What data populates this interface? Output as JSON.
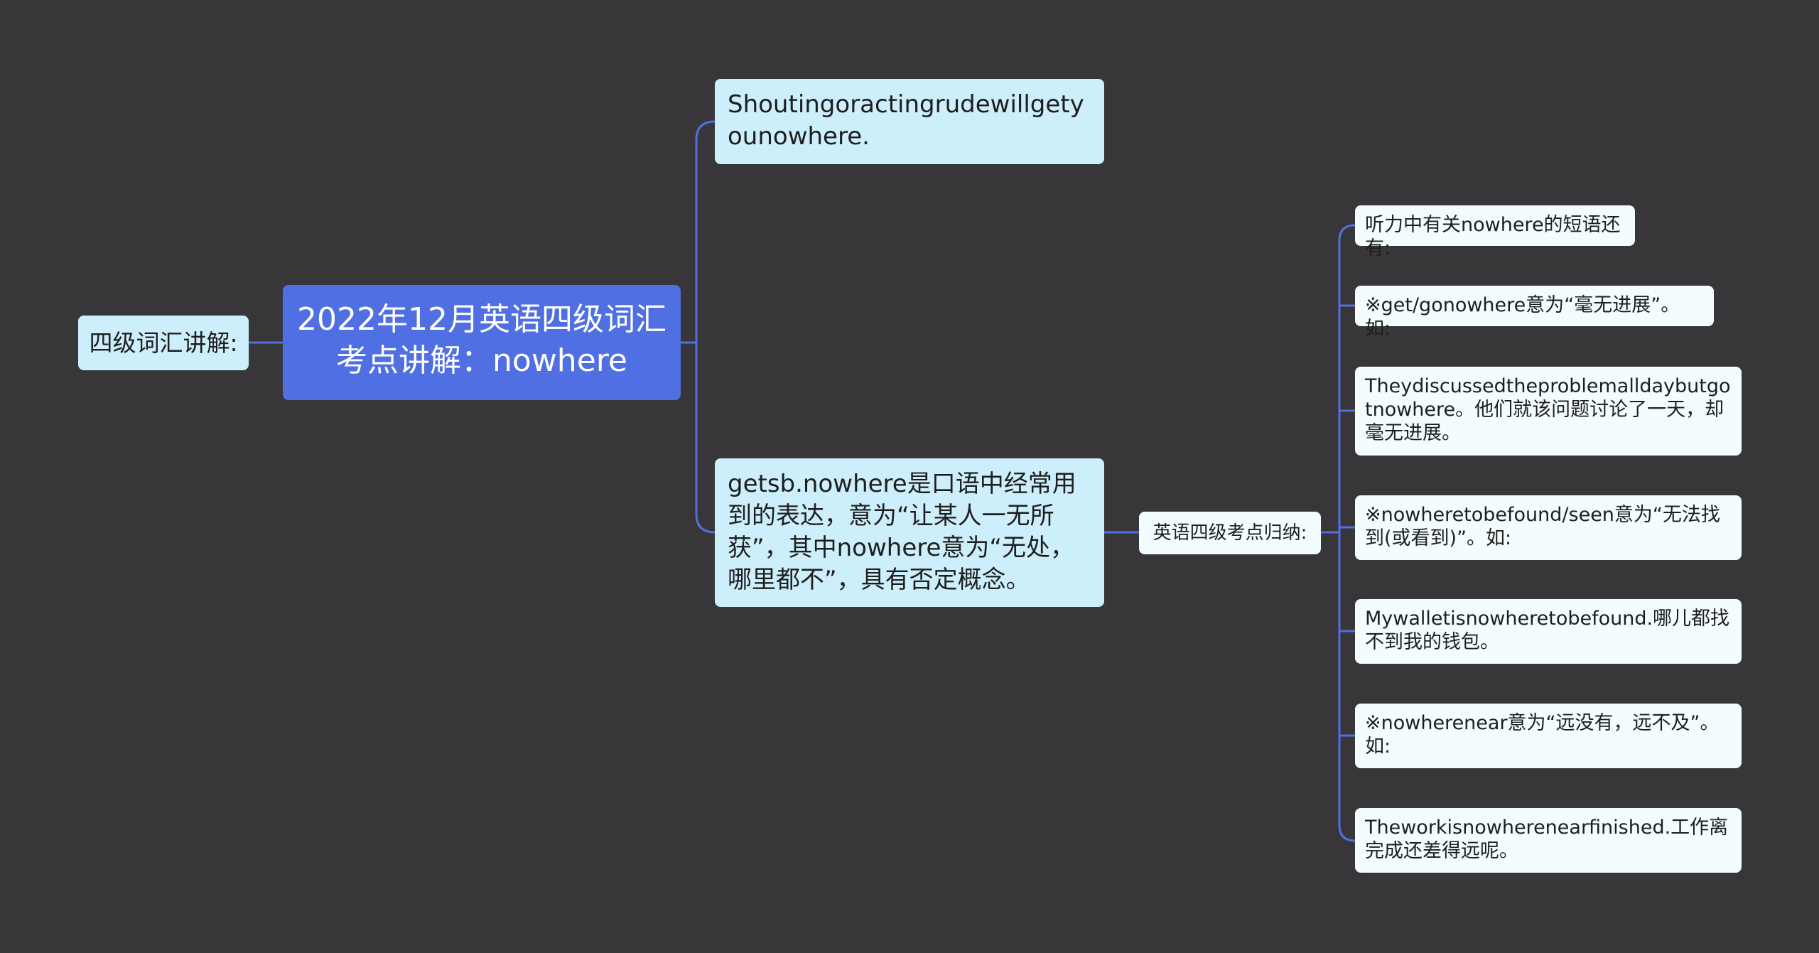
{
  "mindmap": {
    "root": {
      "title": "2022年12月英语四级词汇考点讲解：nowhere"
    },
    "left_label": "四级词汇讲解:",
    "branches": [
      {
        "text": "Shoutingoractingrudewillgetyounowhere."
      },
      {
        "text": "getsb.nowhere是口语中经常用到的表达，意为“让某人一无所获”，其中nowhere意为“无处，哪里都不”，具有否定概念。",
        "child": {
          "label": "英语四级考点归纳:",
          "leaves": [
            "听力中有关nowhere的短语还有:",
            "※get/gonowhere意为“毫无进展”。如:",
            "Theydiscussedtheproblemalldaybutgotnowhere。他们就该问题讨论了一天，却毫无进展。",
            "※nowheretobefound/seen意为“无法找到(或看到)”。如:",
            "Mywalletisnowheretobefound.哪儿都找不到我的钱包。",
            "※nowherenear意为“远没有，远不及”。如:",
            "Theworkisnowherenearfinished.工作离完成还差得远呢。"
          ]
        }
      }
    ]
  },
  "colors": {
    "background": "#383638",
    "root_fill": "#4f6fe3",
    "branch_fill": "#cdeefb",
    "leaf_fill": "#f3fdfe",
    "connector": "#4f6fe3"
  }
}
